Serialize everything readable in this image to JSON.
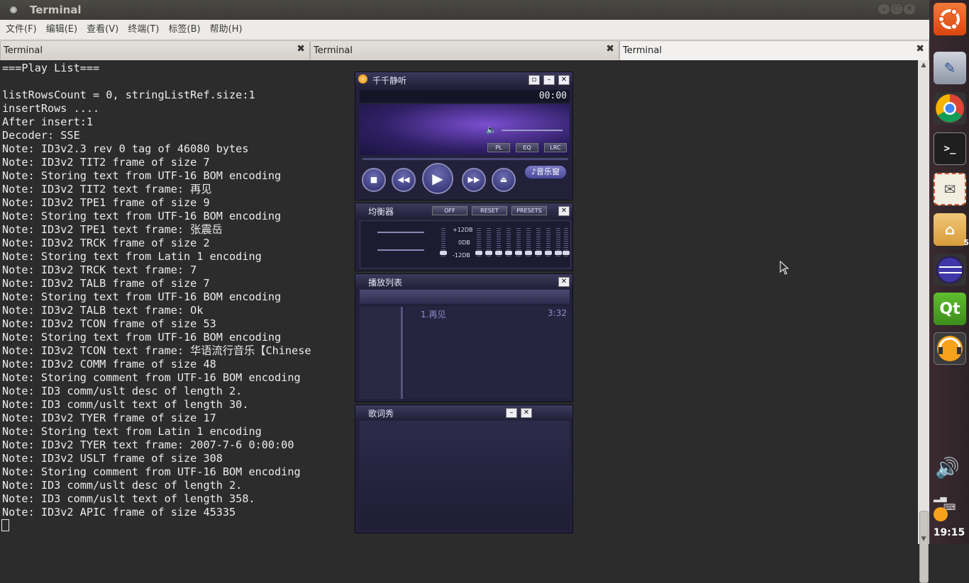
{
  "window": {
    "title": "Terminal"
  },
  "menu": [
    "文件(F)",
    "编辑(E)",
    "查看(V)",
    "终端(T)",
    "标签(B)",
    "帮助(H)"
  ],
  "tabs": [
    {
      "label": "Terminal"
    },
    {
      "label": "Terminal"
    },
    {
      "label": "Terminal"
    }
  ],
  "terminal_lines": [
    "===Play List===",
    "",
    "listRowsCount = 0, stringListRef.size:1",
    "insertRows ....",
    "After insert:1",
    "Decoder: SSE",
    "Note: ID3v2.3 rev 0 tag of 46080 bytes",
    "Note: ID3v2 TIT2 frame of size 7",
    "Note: Storing text from UTF-16 BOM encoding",
    "Note: ID3v2 TIT2 text frame: 再见",
    "Note: ID3v2 TPE1 frame of size 9",
    "Note: Storing text from UTF-16 BOM encoding",
    "Note: ID3v2 TPE1 text frame: 张震岳",
    "Note: ID3v2 TRCK frame of size 2",
    "Note: Storing text from Latin 1 encoding",
    "Note: ID3v2 TRCK text frame: 7",
    "Note: ID3v2 TALB frame of size 7",
    "Note: Storing text from UTF-16 BOM encoding",
    "Note: ID3v2 TALB text frame: Ok",
    "Note: ID3v2 TCON frame of size 53",
    "Note: Storing text from UTF-16 BOM encoding",
    "Note: ID3v2 TCON text frame: 华语流行音乐【Chinese",
    "Note: ID3v2 COMM frame of size 48",
    "Note: Storing comment from UTF-16 BOM encoding",
    "Note: ID3 comm/uslt desc of length 2.",
    "Note: ID3 comm/uslt text of length 30.",
    "Note: ID3v2 TYER frame of size 17",
    "Note: Storing text from Latin 1 encoding",
    "Note: ID3v2 TYER text frame: 2007-7-6 0:00:00",
    "Note: ID3v2 USLT frame of size 308",
    "Note: Storing comment from UTF-16 BOM encoding",
    "Note: ID3 comm/uslt desc of length 2.",
    "Note: ID3 comm/uslt text of length 358.",
    "Note: ID3v2 APIC frame of size 45335"
  ],
  "player": {
    "title": "千千静听",
    "time": "00:00",
    "pl": "PL",
    "eq": "EQ",
    "lrc": "LRC",
    "music_window": "♪音乐窗"
  },
  "equalizer": {
    "title": "均衡器",
    "off": "OFF",
    "reset": "RESET",
    "presets": "PRESETS",
    "db_high": "+12DB",
    "db_mid": "0DB",
    "db_low": "-12DB"
  },
  "playlist": {
    "title": "播放列表",
    "items": [
      {
        "name": "1.再见",
        "duration": "3:32"
      }
    ]
  },
  "lyrics": {
    "title": "歌词秀"
  },
  "launcher": {
    "home_badge": "5"
  },
  "clock": "19:15",
  "colors": {
    "terminal_bg": "#2c2c2c",
    "terminal_fg": "#ececec",
    "ubuntu_orange": "#e95420",
    "player_bg": "#23213a"
  }
}
